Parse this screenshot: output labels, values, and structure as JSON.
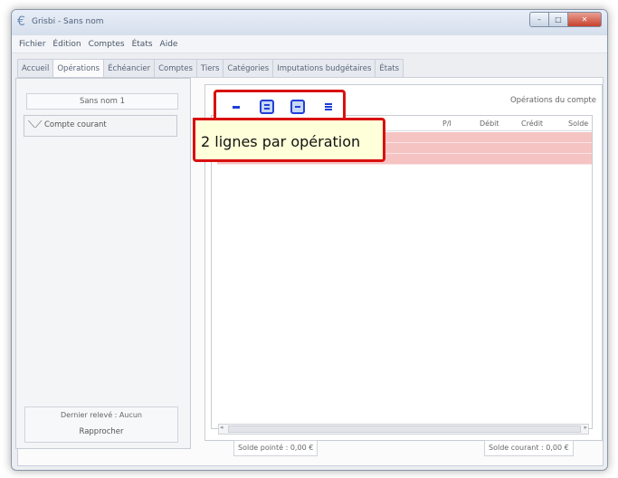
{
  "window": {
    "title": "Grisbi - Sans nom",
    "min_glyph": "–",
    "max_glyph": "□",
    "close_glyph": "✕"
  },
  "menu": [
    "Fichier",
    "Édition",
    "Comptes",
    "États",
    "Aide"
  ],
  "tabs": [
    {
      "label": "Accueil",
      "active": false
    },
    {
      "label": "Opérations",
      "active": true
    },
    {
      "label": "Échéancier",
      "active": false
    },
    {
      "label": "Comptes",
      "active": false
    },
    {
      "label": "Tiers",
      "active": false
    },
    {
      "label": "Catégories",
      "active": false
    },
    {
      "label": "Imputations budgétaires",
      "active": false
    },
    {
      "label": "États",
      "active": false
    }
  ],
  "left_panel": {
    "accounts_title": "Sans nom 1",
    "account_label": "Compte courant",
    "last_statement": "Dernier relevé : Aucun",
    "reconcile_button": "Rapprocher"
  },
  "right_panel": {
    "heading": "Opérations du compte",
    "columns": [
      "P/I",
      "Débit",
      "Crédit",
      "Solde"
    ],
    "row_color": "#f6c3c3",
    "solde_pointe": "Solde pointé : 0,00 €",
    "solde_courant": "Solde courant : 0,00 €"
  },
  "view_buttons": [
    {
      "icon": "one-line-view-icon"
    },
    {
      "icon": "two-lines-view-icon"
    },
    {
      "icon": "three-lines-view-icon"
    },
    {
      "icon": "four-lines-view-icon"
    }
  ],
  "tooltip": {
    "text": "2 lignes par opération"
  },
  "colors": {
    "highlight": "#d8110e",
    "accent": "#1f3fd6",
    "tooltip_bg": "#ffffd9"
  }
}
